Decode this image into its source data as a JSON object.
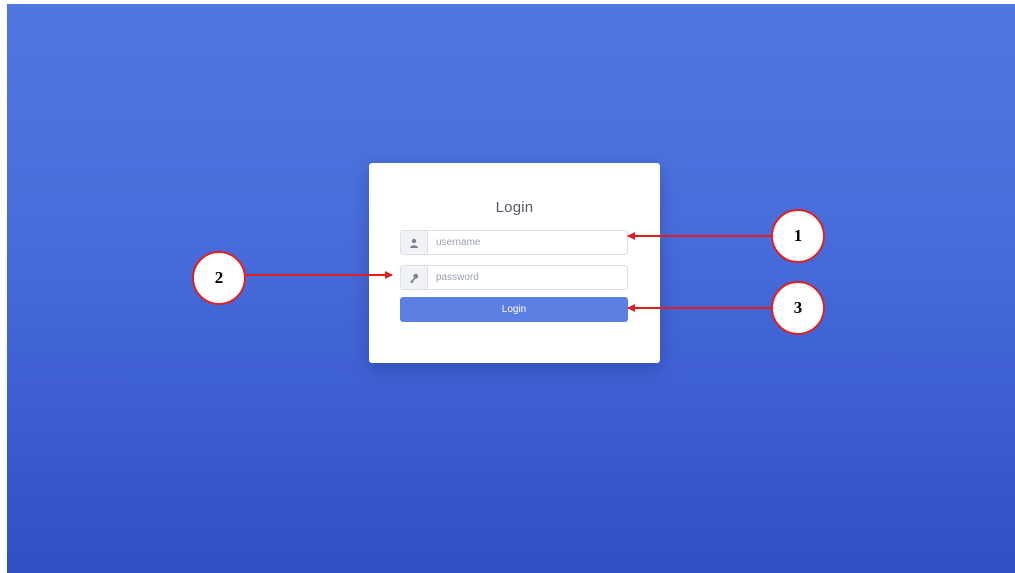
{
  "login": {
    "title": "Login",
    "username_placeholder": "username",
    "password_placeholder": "password",
    "button_label": "Login"
  },
  "icons": {
    "username": "user-icon",
    "password": "key-icon"
  },
  "callouts": [
    {
      "number": "1",
      "target": "username-field"
    },
    {
      "number": "2",
      "target": "password-field"
    },
    {
      "number": "3",
      "target": "login-button"
    }
  ],
  "colors": {
    "background_top": "#5077e0",
    "background_bottom": "#2f4fc4",
    "button": "#5b7fe3",
    "callout_border": "#e02020",
    "arrow": "#e02020"
  }
}
